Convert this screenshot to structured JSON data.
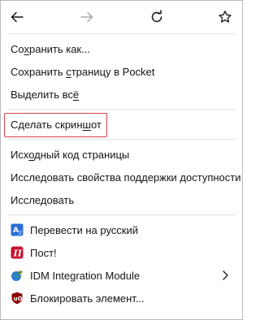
{
  "nav": {
    "back_icon": "arrow-left-icon",
    "forward_icon": "arrow-right-icon",
    "reload_icon": "reload-icon",
    "bookmark_icon": "star-icon"
  },
  "group1": [
    {
      "pre": "Со",
      "acc": "х",
      "post": "ранить как..."
    },
    {
      "pre": "Сохранить ",
      "acc": "с",
      "post": "траницу в Pocket"
    },
    {
      "pre": "Выделить вс",
      "acc": "ё",
      "post": ""
    }
  ],
  "group2": [
    {
      "pre": "Сделать скрин",
      "acc": "ш",
      "post": "от"
    }
  ],
  "group3": [
    {
      "pre": "Исх",
      "acc": "о",
      "post": "дный код страницы"
    },
    {
      "pre": "Исследовать свойства поддержки доступности",
      "acc": "",
      "post": ""
    },
    {
      "pre": "Иссле",
      "acc": "д",
      "post": "овать"
    }
  ],
  "group4": [
    {
      "label": "Перевести на русский",
      "icon": "translate-icon",
      "icon_color": "#2a6fd6"
    },
    {
      "label": "Пост!",
      "icon": "pocket-post-icon",
      "icon_color": "#c8102e"
    },
    {
      "label": "IDM Integration Module",
      "icon": "idm-globe-icon",
      "icon_color": "#2e8b3a",
      "submenu_icon": "chevron-right-icon"
    },
    {
      "label": "Блокировать элемент...",
      "icon": "ublock-origin-icon",
      "icon_color": "#8b0000"
    }
  ],
  "colors": {
    "highlight_border": "#d4404a",
    "separator": "#e0e0e6",
    "text": "#15141a"
  }
}
